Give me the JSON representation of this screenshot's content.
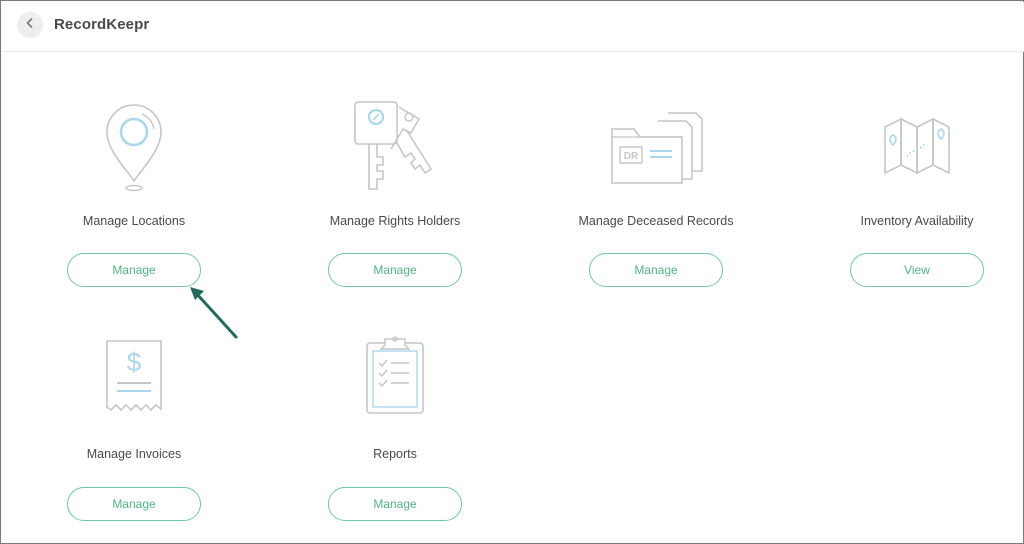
{
  "header": {
    "title": "RecordKeepr"
  },
  "cards": [
    {
      "label": "Manage Locations",
      "button": "Manage",
      "icon": "location-pin-icon"
    },
    {
      "label": "Manage Rights Holders",
      "button": "Manage",
      "icon": "keys-icon"
    },
    {
      "label": "Manage Deceased Records",
      "button": "Manage",
      "icon": "folder-documents-icon"
    },
    {
      "label": "Inventory Availability",
      "button": "View",
      "icon": "map-icon"
    },
    {
      "label": "Manage Invoices",
      "button": "Manage",
      "icon": "receipt-dollar-icon"
    },
    {
      "label": "Reports",
      "button": "Manage",
      "icon": "clipboard-checklist-icon"
    }
  ],
  "folder_icon_text": "DR",
  "receipt_icon_symbol": "$",
  "colors": {
    "accent": "#4fb583",
    "button_border": "#6cc9a2",
    "icon_gray": "#c4c6c8",
    "icon_blue": "#a9d8ee",
    "annotation_arrow": "#1f6b5e"
  }
}
